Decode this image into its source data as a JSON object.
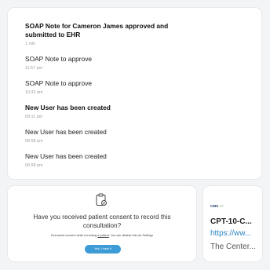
{
  "notifications": [
    {
      "title": "SOAP Note for Cameron James approved and submitted to EHR",
      "time": "1 min",
      "bold": true
    },
    {
      "title": "SOAP Note to approve",
      "time": "11:57 pm",
      "bold": false
    },
    {
      "title": "SOAP Note to approve",
      "time": "10:32 pm",
      "bold": false
    },
    {
      "title": "New User has been created",
      "time": "09:11 pm",
      "bold": true
    },
    {
      "title": "New User has been created",
      "time": "06:58 pm",
      "bold": false
    },
    {
      "title": "New User has been created",
      "time": "06:58 pm",
      "bold": false
    }
  ],
  "consent": {
    "icon": "clipboard-check-icon",
    "question": "Have you received patient consent to record this consultation?",
    "note_before": "Document consent while recording ",
    "note_link": "a patient",
    "note_after": ". You can disable this via Settings",
    "button_label": "Yes, I have it"
  },
  "code_card": {
    "logo_text": "CMS",
    "logo_suffix": ".gov",
    "code": "CPT-10-C...",
    "url": "https://ww...",
    "description": "The Center..."
  },
  "colors": {
    "background": "#f3f4f6",
    "button": "#3d9bd6",
    "link": "#2e86c1",
    "muted_time": "#9a9ca3"
  }
}
